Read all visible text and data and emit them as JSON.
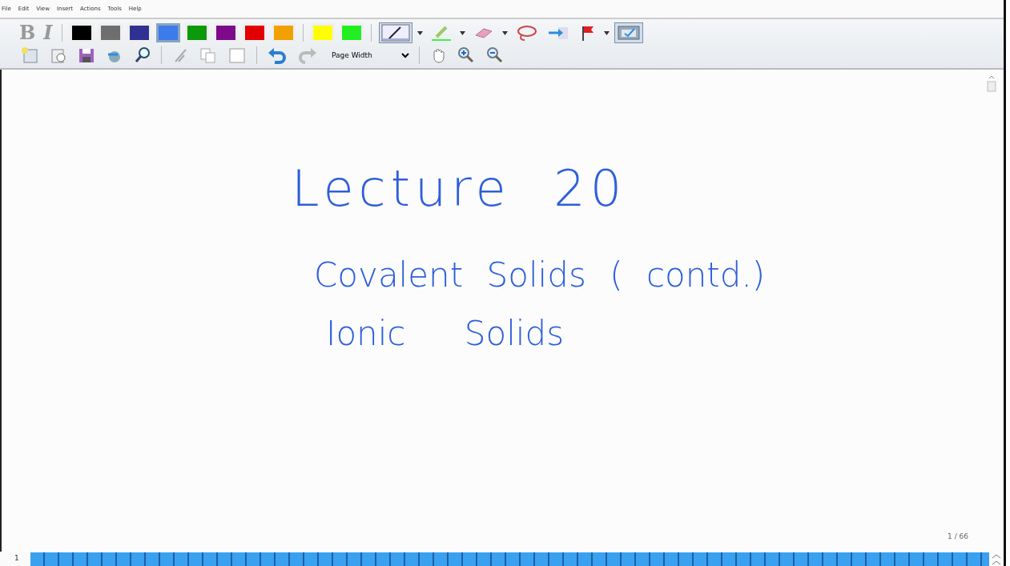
{
  "menu": [
    "File",
    "Edit",
    "View",
    "Insert",
    "Actions",
    "Tools",
    "Help"
  ],
  "format_buttons": [
    {
      "label": "B",
      "disabled": true
    },
    {
      "label": "I",
      "disabled": true
    }
  ],
  "pen_colors": [
    {
      "color": "#000000",
      "selected": false
    },
    {
      "color": "#6e6e6e",
      "selected": false
    },
    {
      "color": "#2e3192",
      "selected": false
    },
    {
      "color": "#3b7bea",
      "selected": true
    },
    {
      "color": "#0a9a0a",
      "selected": false
    },
    {
      "color": "#7d0a8a",
      "selected": false
    },
    {
      "color": "#e00000",
      "selected": false
    },
    {
      "color": "#f0a000",
      "selected": false
    },
    {
      "color": "#ffff00",
      "selected": false
    },
    {
      "color": "#22ee22",
      "selected": false
    }
  ],
  "tools": [
    {
      "kind": "pen",
      "selected": true
    },
    {
      "kind": "highlighter",
      "selected": false
    },
    {
      "kind": "eraser",
      "selected": false
    },
    {
      "kind": "lasso",
      "selected": false
    },
    {
      "kind": "insert-space",
      "selected": false
    },
    {
      "kind": "flag",
      "selected": false
    },
    {
      "kind": "selection",
      "selected": true
    }
  ],
  "zoom": {
    "value": "Page Width"
  },
  "ink_lines": [
    "Lecture 20",
    "Covalent Solids ( contd.)",
    "Ionic Solids"
  ],
  "page_indicator": "1 / 66",
  "page_number": "1"
}
